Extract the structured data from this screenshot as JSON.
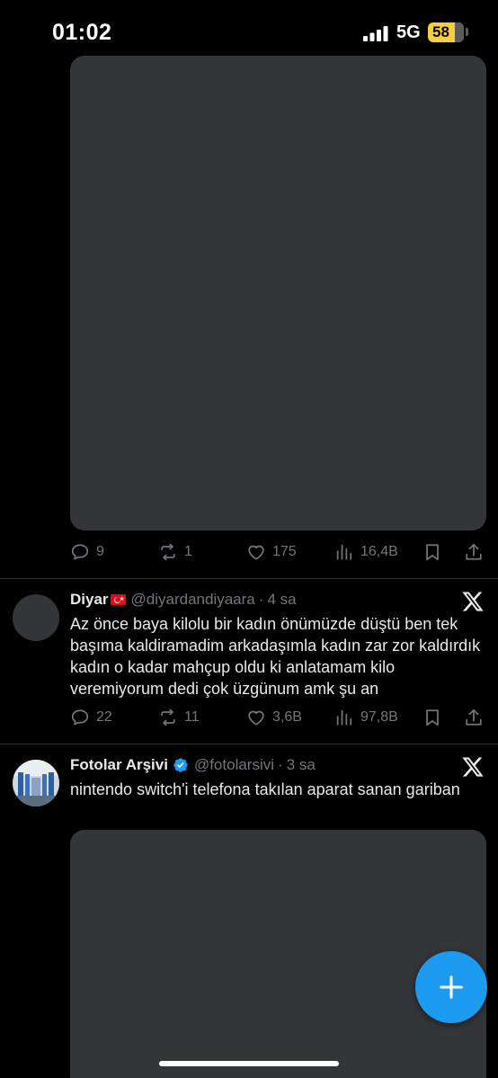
{
  "status_bar": {
    "time": "01:02",
    "network": "5G",
    "battery": "58"
  },
  "tweet1": {
    "actions": {
      "replies": "9",
      "reposts": "1",
      "likes": "175",
      "views": "16,4B"
    }
  },
  "tweet2": {
    "name": "Diyar",
    "handle": "@diyardandiyaara",
    "separator": "·",
    "time": "4 sa",
    "text": "Az önce baya kilolu bir kadın önümüzde düştü ben tek başıma kaldiramadim arkadaşımla kadın zar zor kaldırdık kadın o kadar mahçup oldu ki anlatamam kilo veremiyorum dedi çok üzgünum amk şu an",
    "actions": {
      "replies": "22",
      "reposts": "11",
      "likes": "3,6B",
      "views": "97,8B"
    }
  },
  "tweet3": {
    "name": "Fotolar Arşivi",
    "handle": "@fotolarsivi",
    "separator": "·",
    "time": "3 sa",
    "text": "nintendo switch'i telefona takılan aparat sanan gariban"
  },
  "colors": {
    "background": "#000000",
    "text": "#e7e9ea",
    "secondary": "#71767b",
    "accent": "#1d9bf0",
    "media_placeholder": "#333639",
    "battery": "#f4d03f"
  },
  "icons": [
    "reply-icon",
    "repost-icon",
    "like-icon",
    "views-icon",
    "bookmark-icon",
    "share-icon",
    "x-logo-icon",
    "verified-icon",
    "compose-icon"
  ]
}
